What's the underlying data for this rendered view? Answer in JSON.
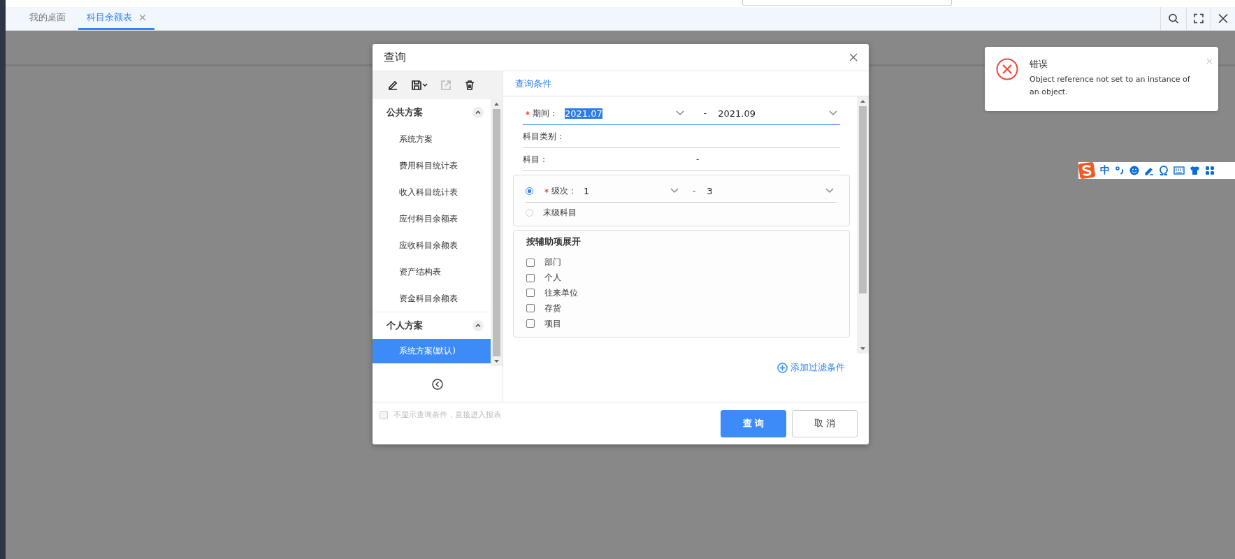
{
  "app_tabs": [
    {
      "label": "我的桌面",
      "selected": false,
      "closable": false
    },
    {
      "label": "科目余额表",
      "selected": true,
      "closable": true
    }
  ],
  "dialog": {
    "title": "查询",
    "toolbar": [
      {
        "kind": "edit",
        "disabled": false
      },
      {
        "kind": "save",
        "disabled": false
      },
      {
        "kind": "export",
        "disabled": true
      },
      {
        "kind": "delete",
        "disabled": false
      }
    ],
    "scheme_groups": [
      {
        "title": "公共方案",
        "expanded": true,
        "items": [
          {
            "label": "系统方案",
            "selected": false
          },
          {
            "label": "费用科目统计表",
            "selected": false
          },
          {
            "label": "收入科目统计表",
            "selected": false
          },
          {
            "label": "应付科目余额表",
            "selected": false
          },
          {
            "label": "应收科目余额表",
            "selected": false
          },
          {
            "label": "资产结构表",
            "selected": false
          },
          {
            "label": "资金科目余额表",
            "selected": false
          }
        ]
      },
      {
        "title": "个人方案",
        "expanded": true,
        "items": [
          {
            "label": "系统方案(默认)",
            "selected": true
          }
        ]
      }
    ],
    "section_tab": "查询条件",
    "period": {
      "label": "期间：",
      "required": true,
      "from": "2021.07",
      "from_selected": true,
      "separator": "-",
      "to": "2021.09"
    },
    "fields": [
      {
        "label": "科目类别："
      },
      {
        "label": "科目：",
        "separator": "-"
      }
    ],
    "level_options": [
      {
        "kind": "range",
        "label": "级次：",
        "required": true,
        "selected": true,
        "from": "1",
        "separator": "-",
        "to": "3"
      },
      {
        "kind": "plain",
        "label": "末级科目",
        "selected": false
      }
    ],
    "expand_group": {
      "title": "按辅助项展开",
      "options": [
        {
          "label": "部门",
          "checked": false
        },
        {
          "label": "个人",
          "checked": false
        },
        {
          "label": "往来单位",
          "checked": false
        },
        {
          "label": "存货",
          "checked": false
        },
        {
          "label": "项目",
          "checked": false
        }
      ]
    },
    "add_filter": "添加过滤条件",
    "skip_option": {
      "label": "不显示查询条件，直接进入报表",
      "checked": false,
      "disabled": true
    },
    "buttons": [
      {
        "kind": "primary",
        "label": "查 询"
      },
      {
        "kind": "default",
        "label": "取 消"
      }
    ]
  },
  "toast": {
    "title": "错误",
    "message": "Object reference not set to an instance of an object."
  },
  "ime_toolbar": {
    "mode": "中"
  }
}
